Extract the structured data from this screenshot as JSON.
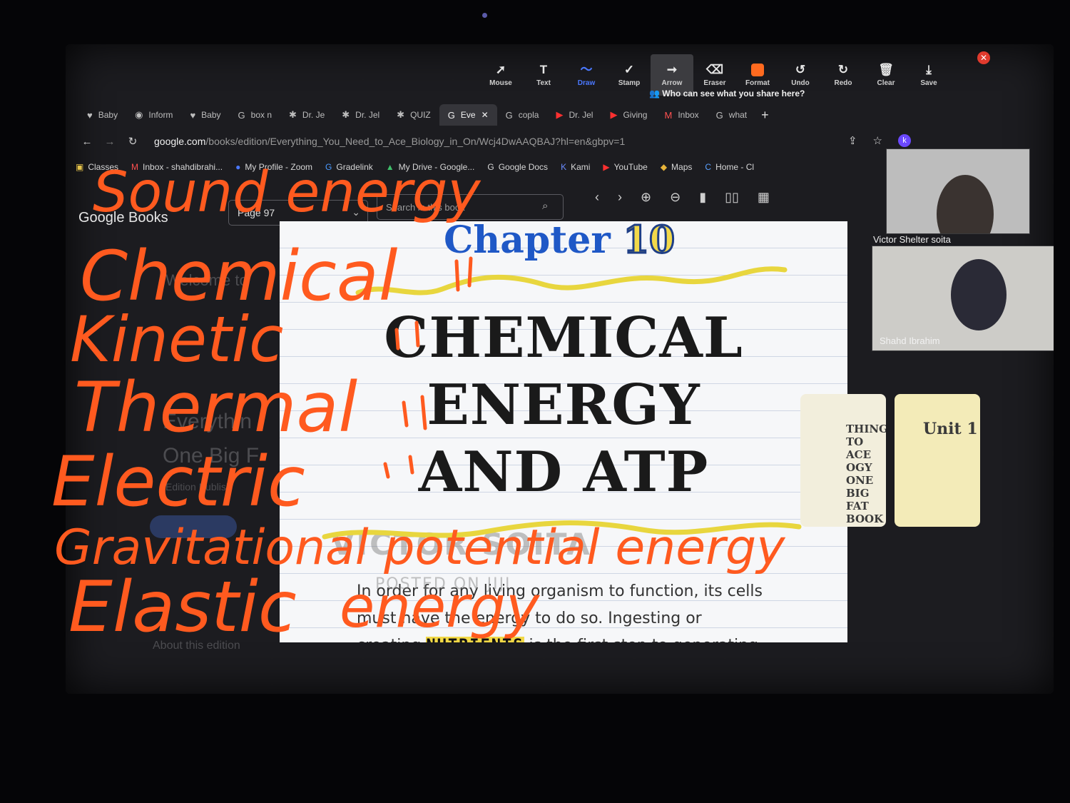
{
  "toolbar": {
    "tools": [
      {
        "id": "mouse",
        "label": "Mouse",
        "icon": "mouse-pointer-icon",
        "glyph": "➚"
      },
      {
        "id": "text",
        "label": "Text",
        "icon": "text-icon",
        "glyph": "T"
      },
      {
        "id": "draw",
        "label": "Draw",
        "icon": "draw-squiggle-icon",
        "glyph": "〜"
      },
      {
        "id": "stamp",
        "label": "Stamp",
        "icon": "checkmark-stamp-icon",
        "glyph": "✓"
      },
      {
        "id": "arrow",
        "label": "Arrow",
        "icon": "arrow-icon",
        "glyph": "➞"
      },
      {
        "id": "eraser",
        "label": "Eraser",
        "icon": "eraser-icon",
        "glyph": "⌫"
      },
      {
        "id": "format",
        "label": "Format",
        "icon": "format-color-icon",
        "glyph": ""
      },
      {
        "id": "undo",
        "label": "Undo",
        "icon": "undo-icon",
        "glyph": "↺"
      },
      {
        "id": "redo",
        "label": "Redo",
        "icon": "redo-icon",
        "glyph": "↻"
      },
      {
        "id": "clear",
        "label": "Clear",
        "icon": "trash-icon",
        "glyph": "🗑"
      },
      {
        "id": "save",
        "label": "Save",
        "icon": "save-icon",
        "glyph": "⤓"
      }
    ],
    "share_note": "Who can see what you share here?"
  },
  "tabs": [
    {
      "label": "Baby",
      "fav": "♥"
    },
    {
      "label": "Inform",
      "fav": "◉"
    },
    {
      "label": "Baby",
      "fav": "♥"
    },
    {
      "label": "box n",
      "fav": "G"
    },
    {
      "label": "Dr. Je",
      "fav": "✱"
    },
    {
      "label": "Dr. Jel",
      "fav": "✱"
    },
    {
      "label": "QUIZ",
      "fav": "✱"
    },
    {
      "label": "Eve",
      "fav": "G",
      "active": true
    },
    {
      "label": "copla",
      "fav": "G"
    },
    {
      "label": "Dr. Jel",
      "fav": "▶"
    },
    {
      "label": "Giving",
      "fav": "▶"
    },
    {
      "label": "Inbox",
      "fav": "M"
    },
    {
      "label": "what",
      "fav": "G"
    }
  ],
  "address": {
    "host": "google.com",
    "path": "/books/edition/Everything_You_Need_to_Ace_Biology_in_On/Wcj4DwAAQBAJ?hl=en&gbpv=1"
  },
  "bookmarks": [
    {
      "label": "Classes",
      "fav": "▣"
    },
    {
      "label": "Inbox - shahdibrahi...",
      "fav": "M"
    },
    {
      "label": "My Profile - Zoom",
      "fav": "●"
    },
    {
      "label": "Gradelink",
      "fav": "G"
    },
    {
      "label": "My Drive - Google...",
      "fav": "▲"
    },
    {
      "label": "Google Docs",
      "fav": "G"
    },
    {
      "label": "Kami",
      "fav": "K"
    },
    {
      "label": "YouTube",
      "fav": "▶"
    },
    {
      "label": "Maps",
      "fav": "◆"
    },
    {
      "label": "Home - Cl",
      "fav": "C"
    }
  ],
  "books": {
    "logo": "Google Books",
    "page": "Page 97",
    "search_placeholder": "Search in this book"
  },
  "sidebar_ghost": [
    "Welcome to",
    "Everythin",
    "One Big F",
    "Edition Publish",
    "About this edition"
  ],
  "page": {
    "chapter_word": "Chapter",
    "chapter_num": "10",
    "title_lines": [
      "CHEMICAL",
      "ENERGY",
      "AND ATP"
    ],
    "body_1": "In order for any living organism to function, its cells must have the energy to do so. Ingesting or creating",
    "body_highlight": "NUTRIENTS",
    "body_2": " is the first step to generating energy"
  },
  "participants": [
    {
      "name": "Victor Shelter soita"
    },
    {
      "name": "Shahd Ibrahim"
    }
  ],
  "thumbnails": [
    {
      "text": "THING TO ACE OGY ONE BIG FAT BOOK"
    },
    {
      "text": "Unit 1"
    }
  ],
  "watermark": {
    "main": "VICTOR SOITA",
    "sub": "POSTED ON JIJI"
  },
  "ink_words": [
    {
      "text": "Sound energy"
    },
    {
      "text": "Chemical"
    },
    {
      "text": "Kinetic"
    },
    {
      "text": "Thermal"
    },
    {
      "text": "Electric"
    },
    {
      "text": "Gravitational potential energy"
    },
    {
      "text": "Elastic"
    },
    {
      "text": "energy"
    }
  ],
  "colors": {
    "ink": "#ff5a1f",
    "highlight": "#f1d846",
    "accent": "#1f58c6"
  }
}
